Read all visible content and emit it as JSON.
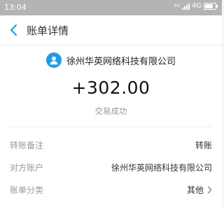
{
  "status_bar": {
    "time": "13:04",
    "network_small": "4G",
    "network": "4G"
  },
  "nav": {
    "title": "账单详情"
  },
  "summary": {
    "payee": "徐州华英网络科技有限公司",
    "amount": "+302.00",
    "status": "交易成功"
  },
  "details": [
    {
      "label": "转账备注",
      "value": "转账"
    },
    {
      "label": "对方账户",
      "value": "徐州华英网络科技有限公司"
    },
    {
      "label": "账单分类",
      "value": "其他"
    }
  ],
  "colors": {
    "accent": "#1e9ce8",
    "status_bar": "#b4b4b4"
  },
  "icons": [
    "back-arrow-icon",
    "user-avatar-icon",
    "chevron-right-icon",
    "signal-icon",
    "battery-icon"
  ]
}
